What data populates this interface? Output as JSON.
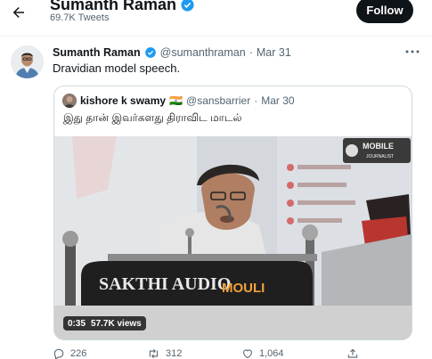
{
  "header": {
    "name": "Sumanth Raman",
    "tweet_count": "69.7K Tweets",
    "follow_label": "Follow"
  },
  "tweet": {
    "author_name": "Sumanth Raman",
    "handle": "@sumanthraman",
    "separator": "·",
    "date": "Mar 31",
    "text": "Dravidian model speech.",
    "stats": {
      "replies": "226",
      "retweets": "312",
      "likes": "1,064"
    }
  },
  "quote": {
    "author_name": "kishore k swamy",
    "flag": "🇮🇳",
    "handle": "@sansbarrier",
    "separator": "·",
    "date": "Mar 30",
    "text": "இது தான் இவர்களது திராவிட மாடல்",
    "video": {
      "duration": "0:35",
      "views": "57.7K views",
      "podium_text_1": "SAKTHI AUDIO",
      "podium_text_2": "MOULI",
      "watermark_1": "MOBILE",
      "watermark_2": "JOURNALIST"
    }
  },
  "colors": {
    "verified": "#1d9bf0",
    "secondary_text": "#536471",
    "follow_bg": "#0f1419"
  },
  "icons": {
    "back": "back-arrow-icon",
    "verified": "verified-badge-icon",
    "more": "more-dots-icon",
    "reply": "reply-icon",
    "retweet": "retweet-icon",
    "like": "heart-icon",
    "share": "share-icon"
  }
}
